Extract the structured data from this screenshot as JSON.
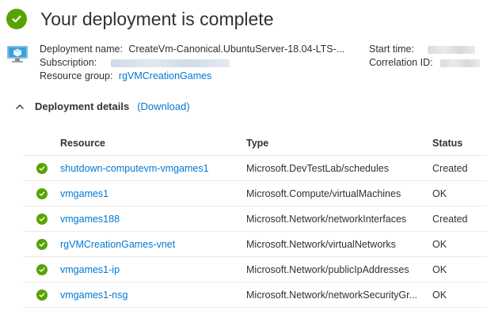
{
  "header": {
    "title": "Your deployment is complete"
  },
  "summary": {
    "deployment_name_label": "Deployment name:",
    "deployment_name_value": "CreateVm-Canonical.UbuntuServer-18.04-LTS-...",
    "subscription_label": "Subscription:",
    "resource_group_label": "Resource group:",
    "resource_group_value": "rgVMCreationGames",
    "start_time_label": "Start time:",
    "correlation_id_label": "Correlation ID:"
  },
  "details": {
    "title": "Deployment details",
    "download_label": "(Download)"
  },
  "table": {
    "columns": [
      "Resource",
      "Type",
      "Status"
    ],
    "rows": [
      {
        "resource": "shutdown-computevm-vmgames1",
        "type": "Microsoft.DevTestLab/schedules",
        "status": "Created"
      },
      {
        "resource": "vmgames1",
        "type": "Microsoft.Compute/virtualMachines",
        "status": "OK"
      },
      {
        "resource": "vmgames188",
        "type": "Microsoft.Network/networkInterfaces",
        "status": "Created"
      },
      {
        "resource": "rgVMCreationGames-vnet",
        "type": "Microsoft.Network/virtualNetworks",
        "status": "OK"
      },
      {
        "resource": "vmgames1-ip",
        "type": "Microsoft.Network/publicIpAddresses",
        "status": "OK"
      },
      {
        "resource": "vmgames1-nsg",
        "type": "Microsoft.Network/networkSecurityGr...",
        "status": "OK"
      }
    ]
  },
  "icons": {
    "success": "check-circle-icon",
    "vm": "virtual-machine-icon",
    "collapse": "chevron-up-icon"
  },
  "colors": {
    "success": "#57a300",
    "link": "#0078d4",
    "text": "#323130"
  }
}
